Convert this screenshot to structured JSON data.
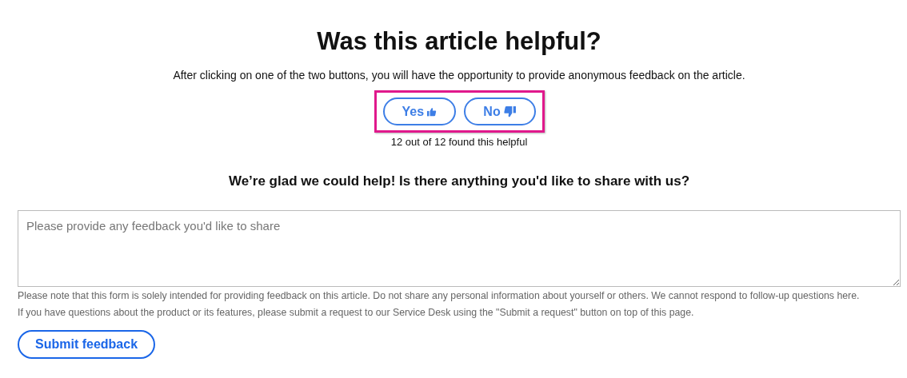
{
  "title": "Was this article helpful?",
  "intro": "After clicking on one of the two buttons, you will have the opportunity to provide anonymous feedback on the article.",
  "vote_buttons": [
    {
      "label": "Yes",
      "kind": "up"
    },
    {
      "label": "No",
      "kind": "down"
    }
  ],
  "highlighted": true,
  "vote_count": "12 out of 12 found this helpful",
  "follow_up": "We’re glad we could help! Is there anything you'd like to share with us?",
  "feedback_field": {
    "placeholder": "Please provide any feedback you'd like to share"
  },
  "notes": [
    "Please note that this form is solely intended for providing feedback on this article. Do not share any personal information about yourself or others. We cannot respond to follow-up questions here.",
    "If you have questions about the product or its features, please submit a request to our Service Desk using the \"Submit a request\" button on top of this page."
  ],
  "submit_button": "Submit feedback"
}
